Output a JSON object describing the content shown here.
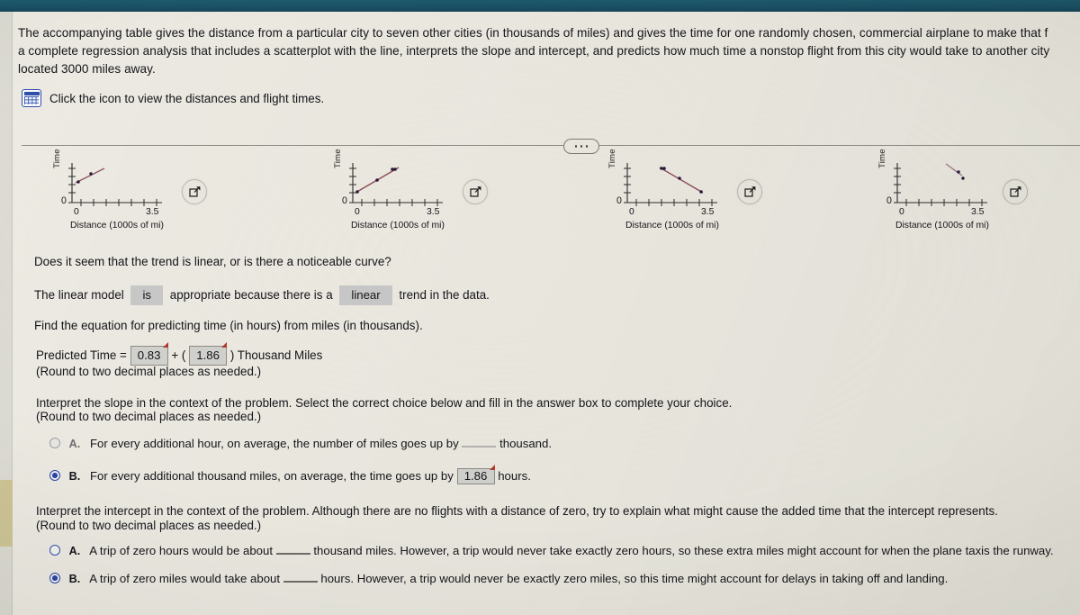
{
  "window": {
    "top_bar_color": "#1a5166",
    "page_bg": "#eceae2"
  },
  "prompt": {
    "line1": "The accompanying table gives the distance from a particular city to seven other cities (in thousands of miles) and gives the time for one randomly chosen, commercial airplane to make that f",
    "line2": "a complete regression analysis that includes a scatterplot with the line, interprets the slope and intercept, and predicts how much time a nonstop flight from this city would take to another city",
    "line3": "located 3000 miles away."
  },
  "attachment": {
    "icon": "table-icon",
    "text": "Click the icon to view the distances and flight times."
  },
  "divider": {
    "ellipsis": "•••"
  },
  "plots": [
    {
      "id": "A",
      "ylabel": "Time",
      "xlabel": "Distance (1000s of mi)",
      "x_tick_min": "0",
      "x_tick_max": "3.5",
      "y_origin": "0",
      "expand_icon": "expand-icon",
      "points": [
        [
          0.15,
          0.52
        ],
        [
          0.55,
          0.72
        ]
      ],
      "line": [
        [
          0.05,
          0.48
        ],
        [
          0.95,
          0.86
        ]
      ]
    },
    {
      "id": "B",
      "ylabel": "Time",
      "xlabel": "Distance (1000s of mi)",
      "x_tick_min": "0",
      "x_tick_max": "3.5",
      "y_origin": "0",
      "expand_icon": "expand-icon",
      "points": [
        [
          0.12,
          0.3
        ],
        [
          0.95,
          0.85
        ],
        [
          1.55,
          0.92
        ]
      ],
      "line": [
        [
          0.08,
          0.26
        ],
        [
          1.7,
          0.95
        ]
      ]
    },
    {
      "id": "C",
      "ylabel": "Time",
      "xlabel": "Distance (1000s of mi)",
      "x_tick_min": "0",
      "x_tick_max": "3.5",
      "y_origin": "0",
      "expand_icon": "expand-icon",
      "points": [
        [
          1.35,
          0.95
        ],
        [
          1.5,
          0.96
        ],
        [
          2.1,
          0.72
        ],
        [
          3.15,
          0.42
        ]
      ],
      "line": [
        [
          1.3,
          0.97
        ],
        [
          3.2,
          0.4
        ]
      ]
    },
    {
      "id": "D",
      "ylabel": "Time",
      "xlabel": "Distance (1000s of mi)",
      "x_tick_min": "0",
      "x_tick_max": "3.5",
      "y_origin": "0",
      "expand_icon": "expand-icon",
      "points": [
        [
          2.35,
          0.92
        ],
        [
          2.85,
          0.7
        ]
      ],
      "line": [
        [
          2.1,
          1.02
        ],
        [
          2.9,
          0.68
        ]
      ]
    }
  ],
  "chart_data": {
    "type": "scatter",
    "title": "",
    "xlabel": "Distance (1000s of mi)",
    "ylabel": "Time",
    "xlim": [
      0,
      3.5
    ],
    "ylim": [
      0,
      1
    ],
    "grid": false,
    "legend": "none",
    "options": [
      {
        "label": "A",
        "description": "points clustered near left, short increasing line",
        "x": [
          0.15,
          0.55
        ],
        "y": [
          0.52,
          0.72
        ],
        "fit_line": {
          "x": [
            0.05,
            0.95
          ],
          "y": [
            0.48,
            0.86
          ]
        }
      },
      {
        "label": "B",
        "description": "increasing line through spread points (correct-looking)",
        "x": [
          0.12,
          0.95,
          1.55
        ],
        "y": [
          0.3,
          0.85,
          0.92
        ],
        "fit_line": {
          "x": [
            0.08,
            1.7
          ],
          "y": [
            0.26,
            0.95
          ]
        }
      },
      {
        "label": "C",
        "description": "decreasing line from mid-left to right",
        "x": [
          1.35,
          1.5,
          2.1,
          3.15
        ],
        "y": [
          0.95,
          0.96,
          0.72,
          0.42
        ],
        "fit_line": {
          "x": [
            1.3,
            3.2
          ],
          "y": [
            0.97,
            0.4
          ]
        }
      },
      {
        "label": "D",
        "description": "short decreasing segment on right",
        "x": [
          2.35,
          2.85
        ],
        "y": [
          0.92,
          0.7
        ],
        "fit_line": {
          "x": [
            2.1,
            2.9
          ],
          "y": [
            1.02,
            0.68
          ]
        }
      }
    ]
  },
  "q_linear": {
    "question": "Does it seem that the trend is linear, or is there a noticeable curve?",
    "answer_prefix": "The linear model",
    "dropdown1": "is",
    "answer_mid": "appropriate because there is a",
    "dropdown2": "linear",
    "answer_suffix": "trend in the data."
  },
  "q_equation": {
    "question": "Find the equation for predicting time (in hours) from miles (in thousands).",
    "label": "Predicted Time =",
    "intercept_value": "0.83",
    "plus": "+",
    "open_paren": "(",
    "slope_value": "1.86",
    "close_paren": ")",
    "units": "Thousand Miles",
    "note": "(Round to two decimal places as needed.)"
  },
  "q_slope": {
    "instruction": "Interpret the slope in the context of the problem. Select the correct choice below and fill in the answer box to complete your choice.",
    "note": "(Round to two decimal places as needed.)",
    "options": [
      {
        "letter": "A.",
        "selected": false,
        "text_before": "For every additional hour, on average, the number of miles goes up by",
        "box_value": "",
        "text_after": "thousand."
      },
      {
        "letter": "B.",
        "selected": true,
        "text_before": "For every additional thousand miles, on average, the time goes up by",
        "box_value": "1.86",
        "text_after": "hours."
      }
    ]
  },
  "q_intercept": {
    "instruction": "Interpret the intercept in the context of the problem. Although there are no flights with a distance of zero, try to explain what might cause the added time that the intercept represents.",
    "note": "(Round to two decimal places as needed.)",
    "options": [
      {
        "letter": "A.",
        "selected": false,
        "text_before": "A trip of zero hours would be about",
        "box_value": "",
        "text_after": "thousand miles. However, a trip would never take exactly zero hours, so these extra miles might account for when the plane taxis the runway."
      },
      {
        "letter": "B.",
        "selected": true,
        "text_before": "A trip of zero miles would take about",
        "box_value": "",
        "text_after": "hours. However, a trip would never be exactly zero miles, so this time might account for delays in taking off and landing."
      }
    ]
  }
}
